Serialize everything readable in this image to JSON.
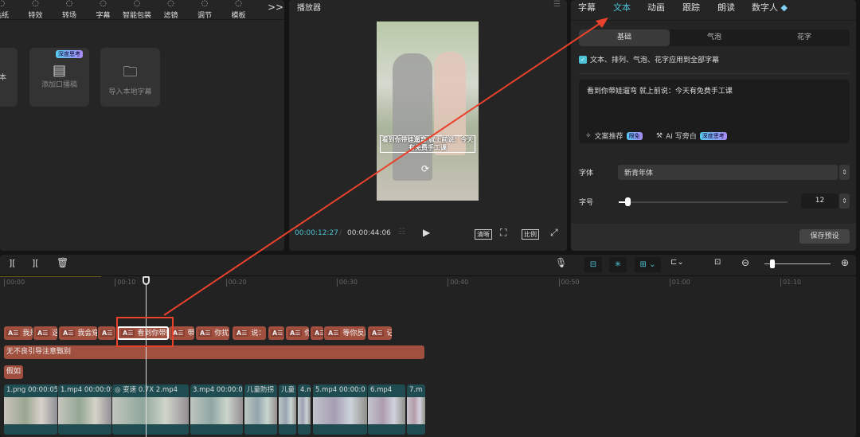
{
  "toolbar": {
    "items": [
      {
        "label": "贴纸",
        "icon": "sticker-icon"
      },
      {
        "label": "特效",
        "icon": "effects-icon"
      },
      {
        "label": "转场",
        "icon": "transition-icon"
      },
      {
        "label": "字幕",
        "icon": "caption-icon"
      },
      {
        "label": "智能包装",
        "icon": "smart-pack-icon"
      },
      {
        "label": "滤镜",
        "icon": "filter-icon"
      },
      {
        "label": "调节",
        "icon": "adjust-icon"
      },
      {
        "label": "模板",
        "icon": "template-icon"
      }
    ],
    "more": ">>"
  },
  "library": {
    "cards": [
      {
        "label": "本"
      },
      {
        "label": "添加口播稿",
        "badge": "深度思考"
      },
      {
        "label": "导入本地字幕"
      }
    ]
  },
  "player": {
    "title": "播放器",
    "current_time": "00:00:12:27",
    "total_time": "00:00:44:06",
    "subtitle_text": "看到你带娃遛弯 就上前说：今天有免费手工课",
    "buttons": {
      "quality": "清晰",
      "ratio": "比例"
    }
  },
  "inspector": {
    "tabs": [
      {
        "label": "字幕"
      },
      {
        "label": "文本",
        "active": true
      },
      {
        "label": "动画"
      },
      {
        "label": "跟踪"
      },
      {
        "label": "朗读"
      },
      {
        "label": "数字人"
      }
    ],
    "subtabs": [
      {
        "label": "基础",
        "active": true
      },
      {
        "label": "气泡"
      },
      {
        "label": "花字"
      }
    ],
    "apply_all": {
      "label": "文本、排列、气泡、花字应用到全部字幕",
      "checked": true
    },
    "text_value": "看到你带娃遛弯 就上前说：今天有免费手工课",
    "copy_suggest": {
      "label": "文案推荐",
      "badge": "限免"
    },
    "ai_narration": {
      "label": "AI 写旁白",
      "badge": "深度思考"
    },
    "font": {
      "label": "字体",
      "value": "新青年体"
    },
    "size": {
      "label": "字号",
      "value": "12",
      "slider_fraction": 0.03
    },
    "save_preset": "保存预设"
  },
  "timeline": {
    "ruler": [
      "00:00",
      "00:10",
      "00:20",
      "00:30",
      "00:40",
      "00:50",
      "01:00",
      "01:10"
    ],
    "caption_clips": [
      "我是",
      "这",
      "我会穿",
      "",
      "看到你带娃",
      "带孩",
      "你扰",
      "说：“",
      "",
      "你",
      "",
      "等你反应",
      "记"
    ],
    "caption_icon": "A☰",
    "text_track_1": "无不良引导注意甄别",
    "text_track_2": "假如",
    "video_clips": [
      {
        "name": "1.png",
        "dur": "00:00:05"
      },
      {
        "name": "1.mp4",
        "dur": "00:00:05"
      },
      {
        "name": "2.mp4",
        "speed": "变速 0.7X"
      },
      {
        "name": "3.mp4",
        "dur": "00:00:0"
      },
      {
        "name": "儿童防拐"
      },
      {
        "name": "儿童"
      },
      {
        "name": "4.m"
      },
      {
        "name": "5.mp4",
        "dur": "00:00:0"
      },
      {
        "name": "6.mp4"
      },
      {
        "name": "7.m"
      }
    ],
    "zoom_fraction": 0.08
  },
  "colors": {
    "accent": "#4cc3d6",
    "clip": "#a1503f",
    "video_clip": "#1f4c50",
    "annotation": "#e8412c"
  }
}
